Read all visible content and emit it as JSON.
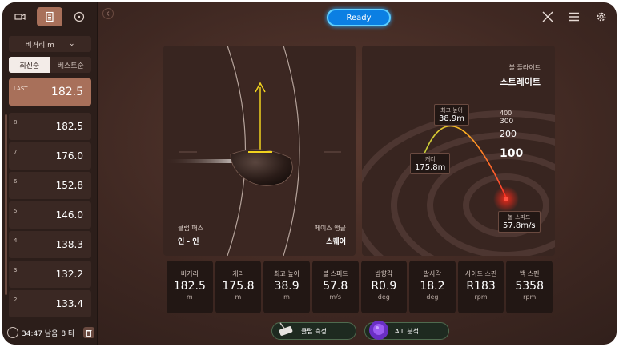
{
  "sidebar": {
    "distance_select": "비거리 m",
    "sort_tabs": [
      "최신순",
      "베스트순"
    ],
    "last": {
      "label": "LAST",
      "value": "182.5"
    },
    "shots": [
      {
        "index": "8",
        "value": "182.5"
      },
      {
        "index": "7",
        "value": "176.0"
      },
      {
        "index": "6",
        "value": "152.8"
      },
      {
        "index": "5",
        "value": "146.0"
      },
      {
        "index": "4",
        "value": "138.3"
      },
      {
        "index": "3",
        "value": "132.2"
      },
      {
        "index": "2",
        "value": "133.4"
      }
    ],
    "timer": "34:47 남음",
    "shot_count": "8 타"
  },
  "header": {
    "status_button": "Ready"
  },
  "club": {
    "path_label": "클럽 패스",
    "path_value": "인 - 인",
    "face_label": "페이스 앵글",
    "face_value": "스퀘어"
  },
  "flight": {
    "type_label": "볼 플라이트",
    "type_value": "스트레이트",
    "apex_label": "최고 높이",
    "apex_value": "38.9m",
    "carry_label": "캐리",
    "carry_value": "175.8m",
    "speed_label": "볼 스피드",
    "speed_value": "57.8m/s",
    "rings": [
      "400",
      "300",
      "200",
      "100"
    ]
  },
  "metrics": [
    {
      "label": "비거리",
      "value": "182.5",
      "unit": "m"
    },
    {
      "label": "캐리",
      "value": "175.8",
      "unit": "m"
    },
    {
      "label": "최고 높이",
      "value": "38.9",
      "unit": "m"
    },
    {
      "label": "볼 스피드",
      "value": "57.8",
      "unit": "m/s"
    },
    {
      "label": "방향각",
      "value": "R0.9",
      "unit": "deg"
    },
    {
      "label": "발사각",
      "value": "18.2",
      "unit": "deg"
    },
    {
      "label": "사이드 스핀",
      "value": "R183",
      "unit": "rpm"
    },
    {
      "label": "백 스핀",
      "value": "5358",
      "unit": "rpm"
    }
  ],
  "actions": {
    "club_measure": "클럽 측정",
    "ai_analysis": "A.I. 분석"
  },
  "colors": {
    "accent": "#a8705a",
    "ready": "#0b7fe3",
    "trajectory_start": "#c8d23a",
    "trajectory_end": "#ff3b30"
  }
}
